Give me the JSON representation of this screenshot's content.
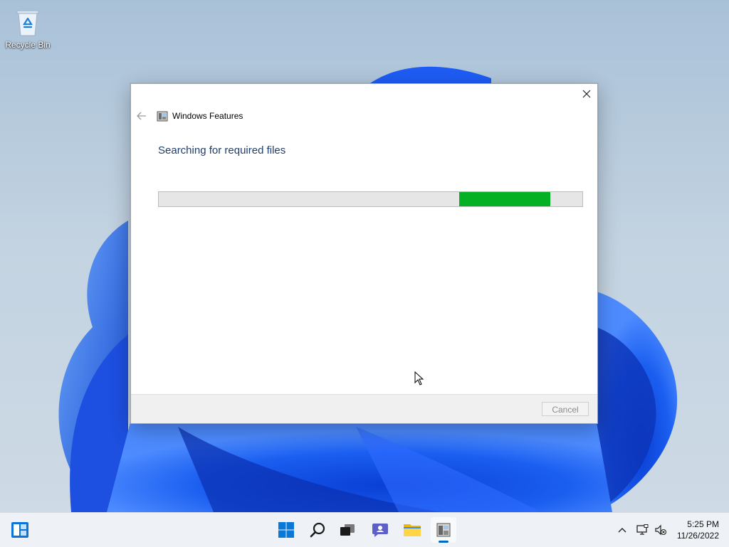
{
  "desktop": {
    "icons": [
      {
        "label": "Recycle Bin",
        "icon": "recycle-bin-icon"
      }
    ]
  },
  "dialog": {
    "title": "Windows Features",
    "heading": "Searching for required files",
    "progress": {
      "mode": "indeterminate",
      "segment_start": 0.71,
      "segment_end": 0.925,
      "color": "#06b025"
    },
    "cancel_label": "Cancel",
    "cancel_enabled": false,
    "accent": "#1f3d6b"
  },
  "taskbar": {
    "apps": [
      {
        "name": "start",
        "icon": "windows-start-icon"
      },
      {
        "name": "search",
        "icon": "search-icon"
      },
      {
        "name": "task-view",
        "icon": "task-view-icon"
      },
      {
        "name": "chat",
        "icon": "teams-chat-icon"
      },
      {
        "name": "file-explorer",
        "icon": "folder-icon"
      },
      {
        "name": "windows-features",
        "icon": "windows-features-icon",
        "active": true
      }
    ],
    "widgets_icon": "widgets-icon",
    "tray": {
      "overflow_icon": "chevron-up-icon",
      "network_icon": "network-icon",
      "volume_icon": "volume-muted-icon"
    },
    "clock": {
      "time": "5:25 PM",
      "date": "11/26/2022"
    }
  }
}
